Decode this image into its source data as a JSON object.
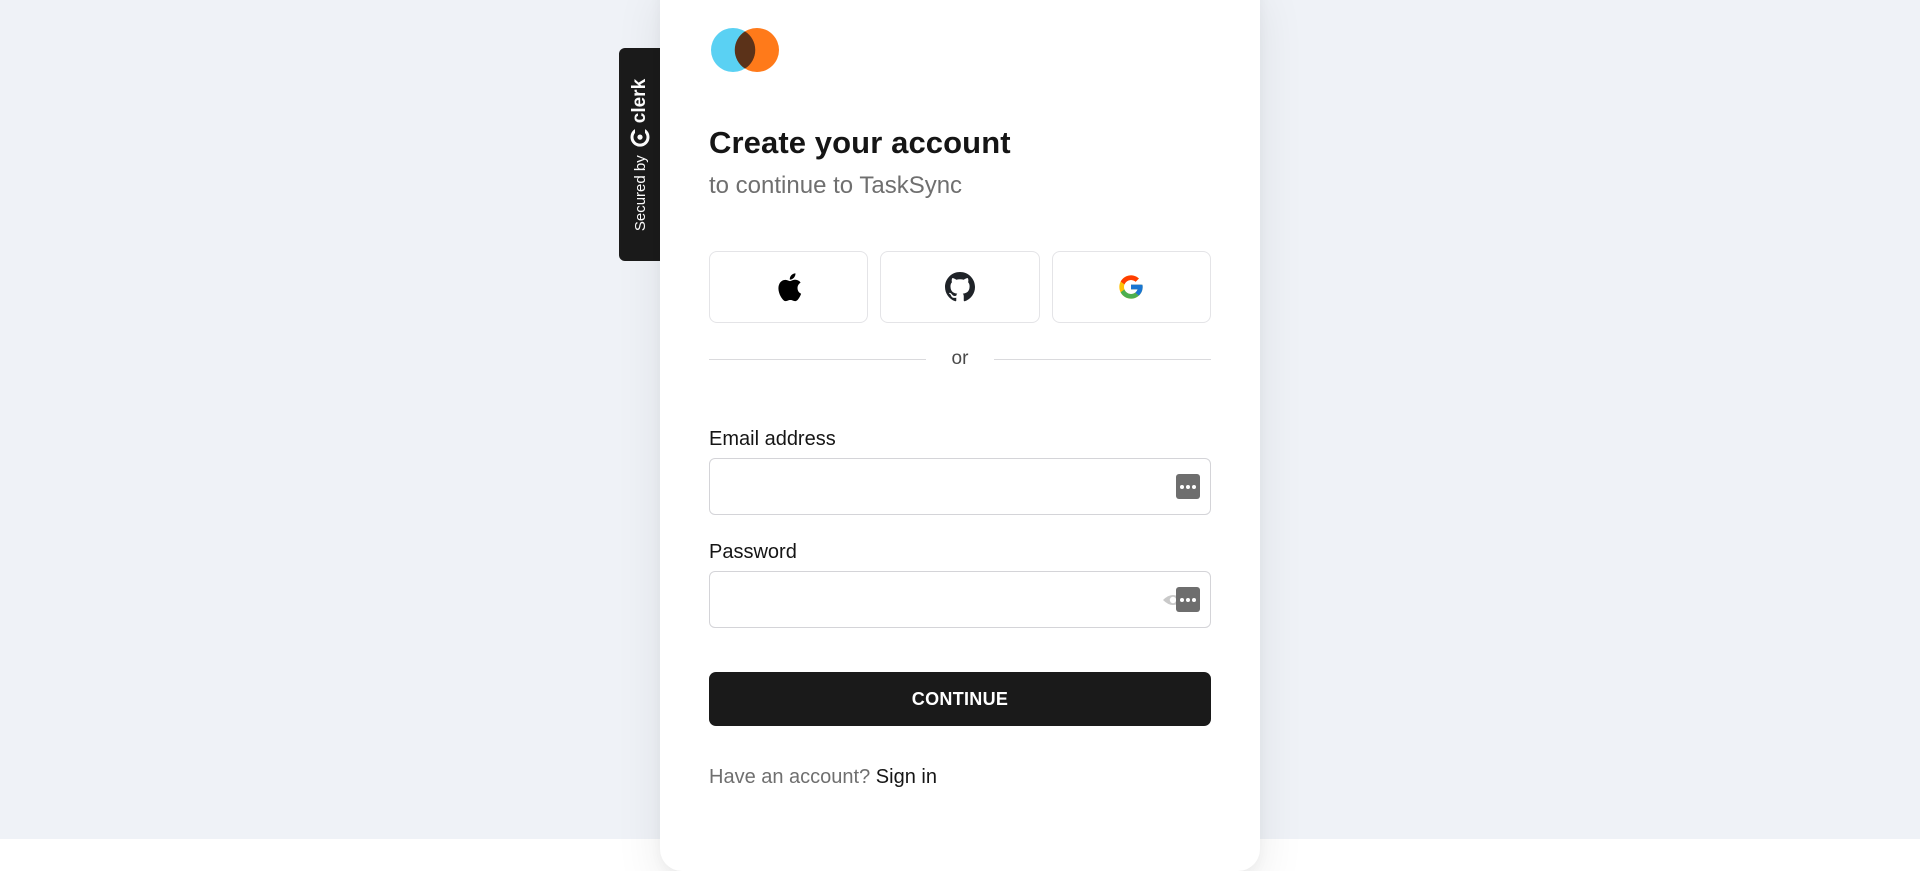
{
  "badge": {
    "secured_label": "Secured by",
    "brand": "clerk"
  },
  "card": {
    "title": "Create your account",
    "subtitle": "to continue to TaskSync"
  },
  "social": [
    {
      "name": "apple",
      "icon": "apple-icon"
    },
    {
      "name": "github",
      "icon": "github-icon"
    },
    {
      "name": "google",
      "icon": "google-icon"
    }
  ],
  "divider": {
    "label": "or"
  },
  "email": {
    "label": "Email address",
    "value": "",
    "placeholder": ""
  },
  "password": {
    "label": "Password",
    "value": "",
    "placeholder": ""
  },
  "actions": {
    "continue_label": "CONTINUE"
  },
  "footer": {
    "prompt": "Have an account?",
    "link": "Sign in"
  },
  "colors": {
    "logo_left": "#5ad1f3",
    "logo_right": "#ff7a1a",
    "logo_overlap": "#5b3219",
    "primary_button": "#1a1a1a",
    "page_background": "#eff2f7"
  }
}
